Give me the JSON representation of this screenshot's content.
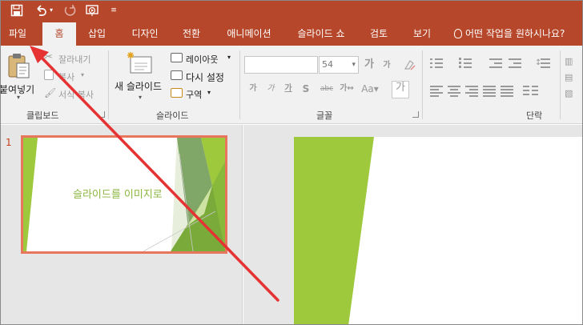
{
  "qat": {
    "save_icon": "save-icon",
    "undo_icon": "undo-icon",
    "redo_icon": "redo-icon",
    "present_icon": "start-from-beginning-icon",
    "customize_icon": "customize-qat-icon"
  },
  "tabs": {
    "file": "파일",
    "home": "홈",
    "insert": "삽입",
    "design": "디자인",
    "transitions": "전환",
    "animations": "애니메이션",
    "slideshow": "슬라이드 쇼",
    "review": "검토",
    "view": "보기",
    "tell_me": "어떤 작업을 원하시나요?"
  },
  "ribbon": {
    "clipboard": {
      "paste": "붙여넣기",
      "cut": "잘라내기",
      "copy": "복사",
      "format_painter": "서식 복사",
      "label": "클립보드"
    },
    "slides": {
      "new_slide": "새 슬라이드",
      "layout": "레이아웃",
      "reset": "다시 설정",
      "section": "구역",
      "label": "슬라이드"
    },
    "font": {
      "font_name": "",
      "font_size": "54",
      "label": "글꼴"
    },
    "paragraph": {
      "label": "단락"
    }
  },
  "thumbnails": {
    "slide_number": "1",
    "slide_title": "슬라이드를 이미지로"
  },
  "colors": {
    "accent": "#b7472a",
    "selected_border": "#e8765c",
    "slide_green": "#9ec93c",
    "arrow": "#e53232"
  }
}
